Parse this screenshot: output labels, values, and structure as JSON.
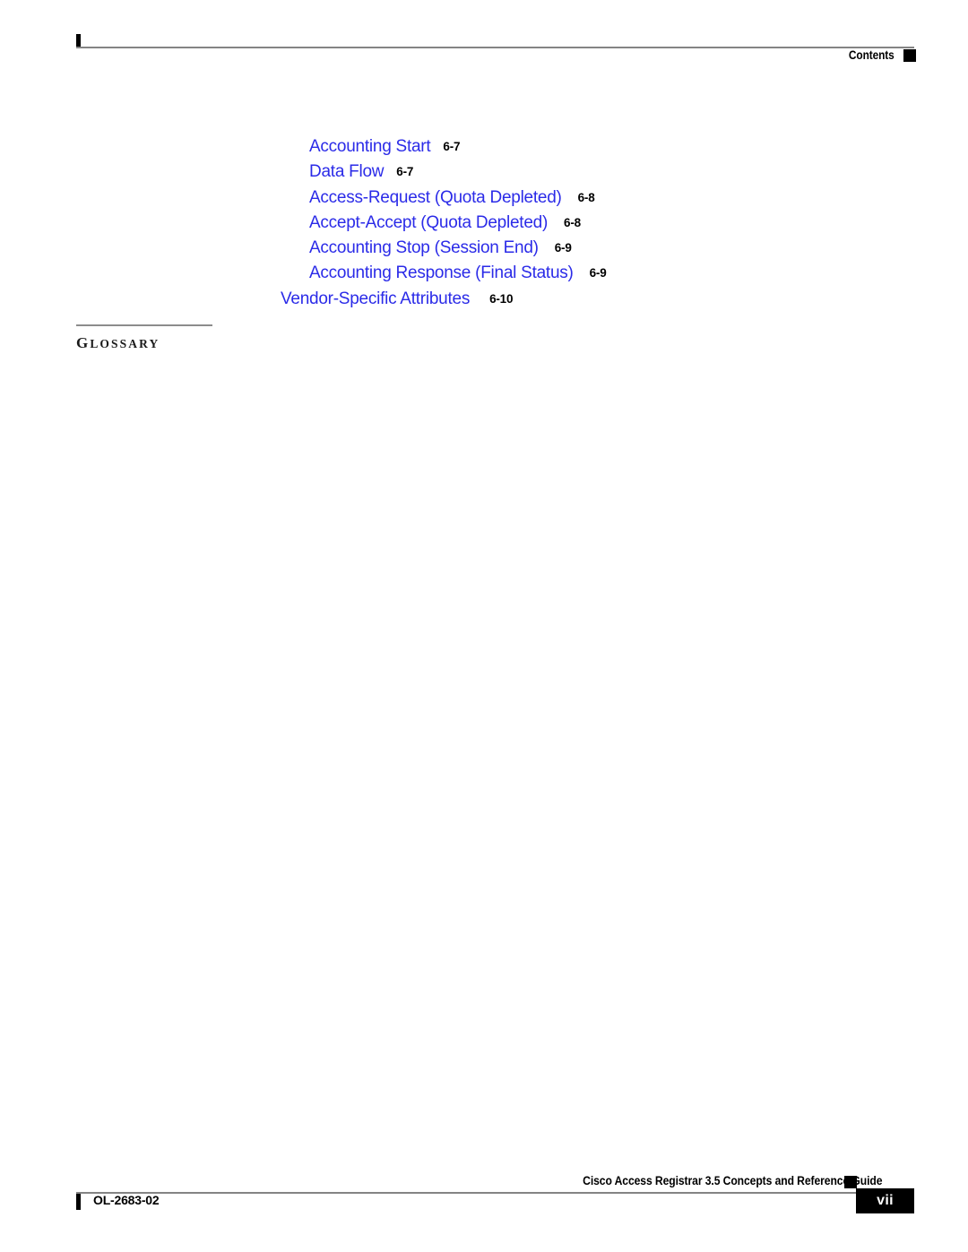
{
  "header": {
    "label": "Contents",
    "marker_icon": "black-square-marker"
  },
  "toc": {
    "entries": [
      {
        "title": "Accounting Start",
        "page": "6-7",
        "level": 3
      },
      {
        "title": "Data Flow",
        "page": "6-7",
        "level": 3
      },
      {
        "title": "Access-Request (Quota Depleted)",
        "page": "6-8",
        "level": 3
      },
      {
        "title": "Accept-Accept (Quota Depleted)",
        "page": "6-8",
        "level": 3
      },
      {
        "title": "Accounting Stop (Session End)",
        "page": "6-9",
        "level": 3
      },
      {
        "title": "Accounting Response (Final Status)",
        "page": "6-9",
        "level": 3
      },
      {
        "title": "Vendor-Specific Attributes",
        "page": "6-10",
        "level": 2
      }
    ],
    "link_color": "#2B2BE8",
    "page_ref_color": "#000000"
  },
  "glossary": {
    "label": "GLOSSARY",
    "label_first_letter": "G",
    "label_rest": "LOSSARY",
    "rule_color": "#8C8C8C"
  },
  "footer": {
    "title": "Cisco Access Registrar 3.5 Concepts and Reference Guide",
    "doc_number": "OL-2683-02",
    "page_number": "vii",
    "marker_icon": "black-square-marker",
    "rule_color": "#848484",
    "page_box_color": "#000000"
  }
}
